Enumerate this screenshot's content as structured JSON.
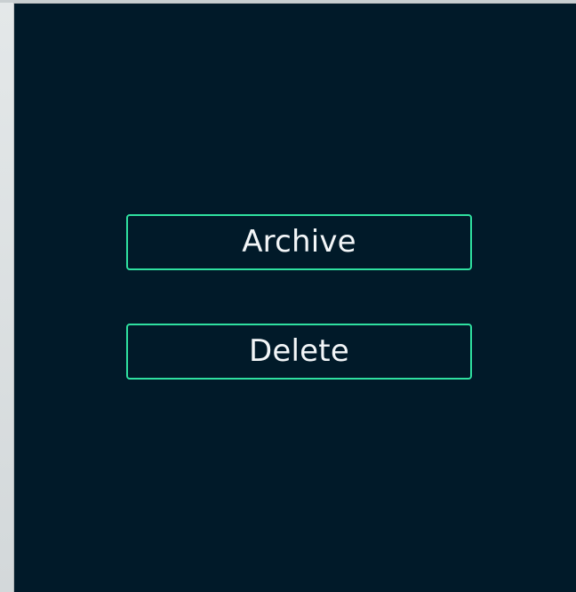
{
  "actions": {
    "archive_label": "Archive",
    "delete_label": "Delete"
  },
  "colors": {
    "background": "#011a29",
    "accent": "#2fe0a0",
    "text": "#f3f6f8"
  }
}
